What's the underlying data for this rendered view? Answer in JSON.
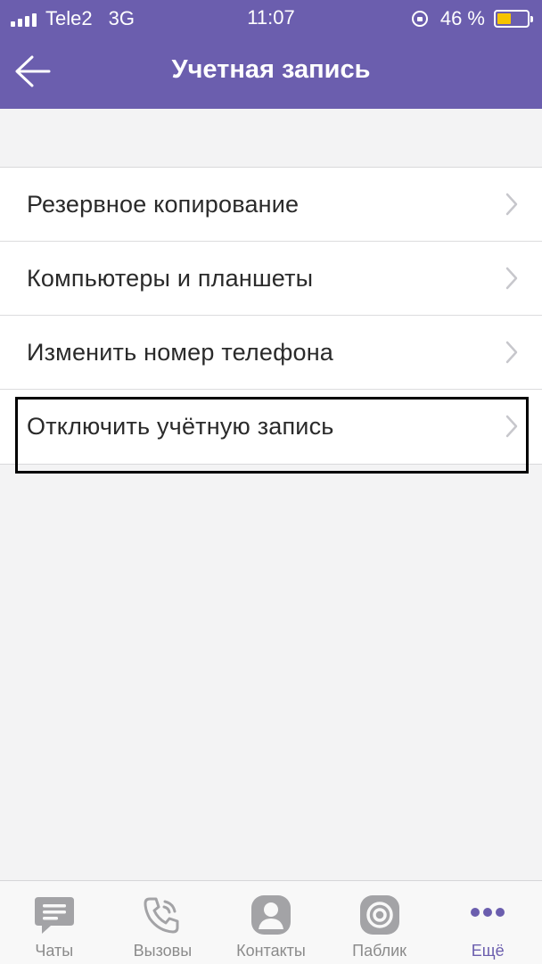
{
  "status_bar": {
    "carrier": "Tele2",
    "network": "3G",
    "time": "11:07",
    "battery_percent_text": "46 %",
    "battery_level": 0.46,
    "battery_color": "#f6c400"
  },
  "header": {
    "title": "Учетная запись",
    "back_icon": "arrow-left-icon",
    "background_color": "#6b5eae"
  },
  "menu": {
    "items": [
      {
        "label": "Резервное копирование",
        "icon": "chevron-right-icon"
      },
      {
        "label": "Компьютеры и планшеты",
        "icon": "chevron-right-icon"
      },
      {
        "label": "Изменить номер телефона",
        "icon": "chevron-right-icon"
      },
      {
        "label": "Отключить учётную запись",
        "icon": "chevron-right-icon",
        "highlighted": true
      }
    ]
  },
  "tabbar": {
    "tabs": [
      {
        "label": "Чаты",
        "icon": "chat-bubble-icon",
        "active": false
      },
      {
        "label": "Вызовы",
        "icon": "phone-icon",
        "active": false
      },
      {
        "label": "Контакты",
        "icon": "contact-person-icon",
        "active": false
      },
      {
        "label": "Паблик",
        "icon": "public-icon",
        "active": false
      },
      {
        "label": "Ещё",
        "icon": "more-dots-icon",
        "active": true
      }
    ],
    "active_color": "#6b5eae",
    "inactive_color": "#a3a3a6"
  }
}
